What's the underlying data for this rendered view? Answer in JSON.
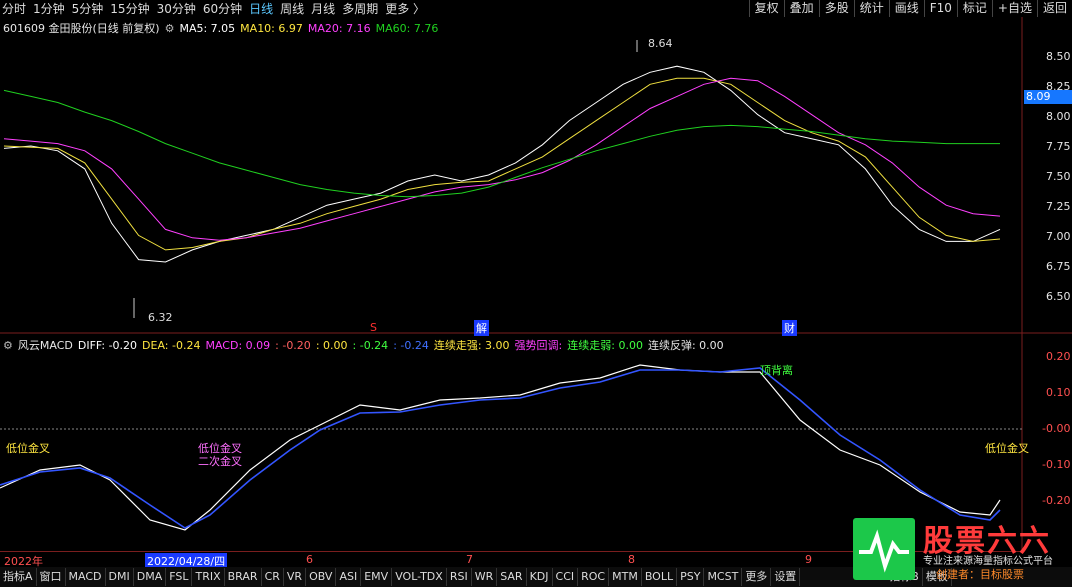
{
  "toolbar": {
    "periods": [
      "分时",
      "1分钟",
      "5分钟",
      "15分钟",
      "30分钟",
      "60分钟",
      "日线",
      "周线",
      "月线",
      "多周期",
      "更多 〉"
    ],
    "selected_period": "日线",
    "actions": [
      "复权",
      "叠加",
      "多股",
      "统计",
      "画线",
      "F10",
      "标记",
      "+自选",
      "返回"
    ]
  },
  "stock": {
    "title": "601609 金田股份(日线 前复权)",
    "ma5": "MA5: 7.05",
    "ma10": "MA10: 6.97",
    "ma20": "MA20: 7.16",
    "ma60": "MA60: 7.76"
  },
  "price_axis": {
    "labels": [
      "8.50",
      "8.25",
      "8.00",
      "7.75",
      "7.50",
      "7.25",
      "7.00",
      "6.75",
      "6.50"
    ],
    "current": "8.09"
  },
  "annotations": {
    "high": "8.64",
    "low": "6.32",
    "marker_s": "S",
    "marker_jie": "解",
    "marker_cai": "财"
  },
  "macd_header": {
    "name": "风云MACD",
    "diff": "DIFF: -0.20",
    "dea": "DEA: -0.24",
    "macd": "MACD: 0.09",
    "v1": ": -0.20",
    "v2": ": 0.00",
    "v3": ": -0.24",
    "v4": ": -0.24",
    "lianxu_qiang": "连续走强: 3.00",
    "qiangshi": "强势回调:",
    "lianxu_ruo": "连续走弱: 0.00",
    "fantan": "连续反弹: 0.00"
  },
  "macd_axis": [
    "0.20",
    "0.10",
    "-0.00",
    "-0.10",
    "-0.20"
  ],
  "macd_notes": {
    "left": "低位金叉",
    "left2": "二次金叉",
    "mid": "低位金叉",
    "right": "低位金叉",
    "top": "顶背离"
  },
  "x_axis": {
    "year": "2022年",
    "selected_date": "2022/04/28/四",
    "m6": "6",
    "m7": "7",
    "m8": "8",
    "m9": "9"
  },
  "tabs": [
    "指标A",
    "窗口",
    "MACD",
    "DMI",
    "DMA",
    "FSL",
    "TRIX",
    "BRAR",
    "CR",
    "VR",
    "OBV",
    "ASI",
    "EMV",
    "VOL-TDX",
    "RSI",
    "WR",
    "SAR",
    "KDJ",
    "CCI",
    "ROC",
    "MTM",
    "BOLL",
    "PSY",
    "MCST",
    "更多",
    "设置"
  ],
  "tabs_right": [
    "指标B",
    "模板"
  ],
  "watermark": {
    "title": "股票六六",
    "slogan": "专业注来源海量指标公式平台",
    "sub": "创建者：目标股票"
  },
  "chart_data": {
    "type": "candlestick",
    "price_range": [
      6.3,
      8.65
    ],
    "ma_series": [
      {
        "name": "MA5",
        "color": "#ffffff",
        "values": [
          7.72,
          7.74,
          7.7,
          7.55,
          7.1,
          6.8,
          6.78,
          6.88,
          6.95,
          7.0,
          7.05,
          7.15,
          7.25,
          7.3,
          7.35,
          7.45,
          7.5,
          7.45,
          7.5,
          7.6,
          7.75,
          7.95,
          8.1,
          8.25,
          8.35,
          8.4,
          8.35,
          8.2,
          8.0,
          7.85,
          7.8,
          7.75,
          7.55,
          7.25,
          7.05,
          6.95,
          6.95,
          7.05
        ]
      },
      {
        "name": "MA10",
        "color": "#f0e040",
        "values": [
          7.74,
          7.73,
          7.72,
          7.6,
          7.3,
          7.0,
          6.88,
          6.9,
          6.95,
          6.98,
          7.05,
          7.1,
          7.18,
          7.24,
          7.3,
          7.38,
          7.42,
          7.44,
          7.45,
          7.55,
          7.65,
          7.8,
          7.95,
          8.1,
          8.25,
          8.3,
          8.3,
          8.25,
          8.1,
          7.95,
          7.85,
          7.78,
          7.65,
          7.4,
          7.15,
          7.0,
          6.95,
          6.97
        ]
      },
      {
        "name": "MA20",
        "color": "#ff40ff",
        "values": [
          7.8,
          7.78,
          7.76,
          7.7,
          7.55,
          7.3,
          7.05,
          6.98,
          6.96,
          6.98,
          7.02,
          7.06,
          7.12,
          7.18,
          7.24,
          7.3,
          7.36,
          7.4,
          7.42,
          7.46,
          7.52,
          7.62,
          7.75,
          7.9,
          8.05,
          8.15,
          8.25,
          8.3,
          8.28,
          8.15,
          8.0,
          7.85,
          7.75,
          7.6,
          7.4,
          7.25,
          7.18,
          7.16
        ]
      },
      {
        "name": "MA60",
        "color": "#20d020",
        "values": [
          8.2,
          8.15,
          8.1,
          8.02,
          7.95,
          7.86,
          7.76,
          7.68,
          7.6,
          7.54,
          7.48,
          7.42,
          7.38,
          7.35,
          7.33,
          7.32,
          7.33,
          7.35,
          7.4,
          7.48,
          7.56,
          7.63,
          7.7,
          7.76,
          7.82,
          7.87,
          7.9,
          7.91,
          7.9,
          7.88,
          7.86,
          7.83,
          7.8,
          7.78,
          7.77,
          7.76,
          7.76,
          7.76
        ]
      }
    ]
  }
}
